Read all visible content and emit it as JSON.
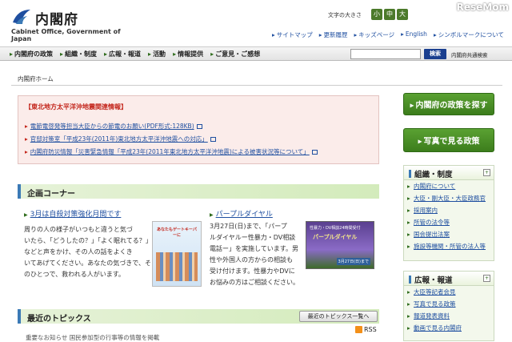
{
  "site": {
    "title": "内閣府",
    "subtitle": "Cabinet Office, Government of Japan",
    "watermark": "ReseMom"
  },
  "fontsize": {
    "label": "文字の大きさ",
    "small": "小",
    "medium": "中",
    "large": "大"
  },
  "toplinks": [
    "サイトマップ",
    "更新履歴",
    "キッズページ",
    "English",
    "シンボルマークについて"
  ],
  "gnav": [
    "内閣府の政策",
    "組織・制度",
    "広報・報道",
    "活動",
    "情報提供",
    "ご意見・ご感想"
  ],
  "search": {
    "button": "検索",
    "common": "内閣府共通検索"
  },
  "breadcrumb": "内閣府ホーム",
  "alert": {
    "title": "【東北地方太平洋沖地震関連情報】",
    "items": [
      "電節電啓発等担当大臣からの節電のお願い(PDF形式:128KB)",
      "官邸対策室「平成23年(2011年)東北地方太平洋沖地震への対応」",
      "内閣府防災情報「災害緊急情報「平成23年(2011年東北地方太平洋沖地震)による被害状況等について」"
    ]
  },
  "kikaku": {
    "title": "企画コーナー",
    "item1": {
      "link": "3月は自殺対策強化月間です",
      "lines": [
        "周りの人の様子がいつもと違うと気づ",
        "いたら、「どうしたの？」「よく眠れてる？」",
        "などと声をかけ、その人の話をよくき",
        "いてあげてください。あなたの気づきで、そ",
        "のひとつで、救われる人がいます。"
      ],
      "poster_title": "あなたもゲートキーパーに"
    },
    "item2": {
      "link": "パープルダイヤル",
      "lines": [
        "3月27日(日)まで、「パープ",
        "ルダイヤルー性暴力・DV相談",
        "電話ー」を実施しています。男",
        "性や外国人の方からの相談も",
        "受け付けます。性暴力やDVに",
        "お悩みの方はご相談ください。"
      ],
      "poster_top": "性暴力・DV相談24時間受付",
      "poster_title": "パープルダイヤル",
      "poster_date": "3月27日(日)まで"
    }
  },
  "topics": {
    "title": "最近のトピックス",
    "button": "最近のトピックス一覧へ",
    "rss": "RSS",
    "first": "重要なお知らせ 国民参加型の行事等の情報を掲載"
  },
  "sidebar": {
    "policy_button": "内閣府の政策を探す",
    "photo_button": "写真で見る政策",
    "soshiki": {
      "title": "組織・制度",
      "items": [
        "内閣府について",
        "大臣・副大臣・大臣政務官",
        "採用案内",
        "所管の法令等",
        "国会提出法案",
        "施設等機関・所管の法人等"
      ]
    },
    "koho": {
      "title": "広報・報道",
      "items": [
        "大臣等記者会見",
        "写真で見る政策",
        "報道発表資料",
        "動画で見る内閣府"
      ]
    },
    "more": "+"
  }
}
